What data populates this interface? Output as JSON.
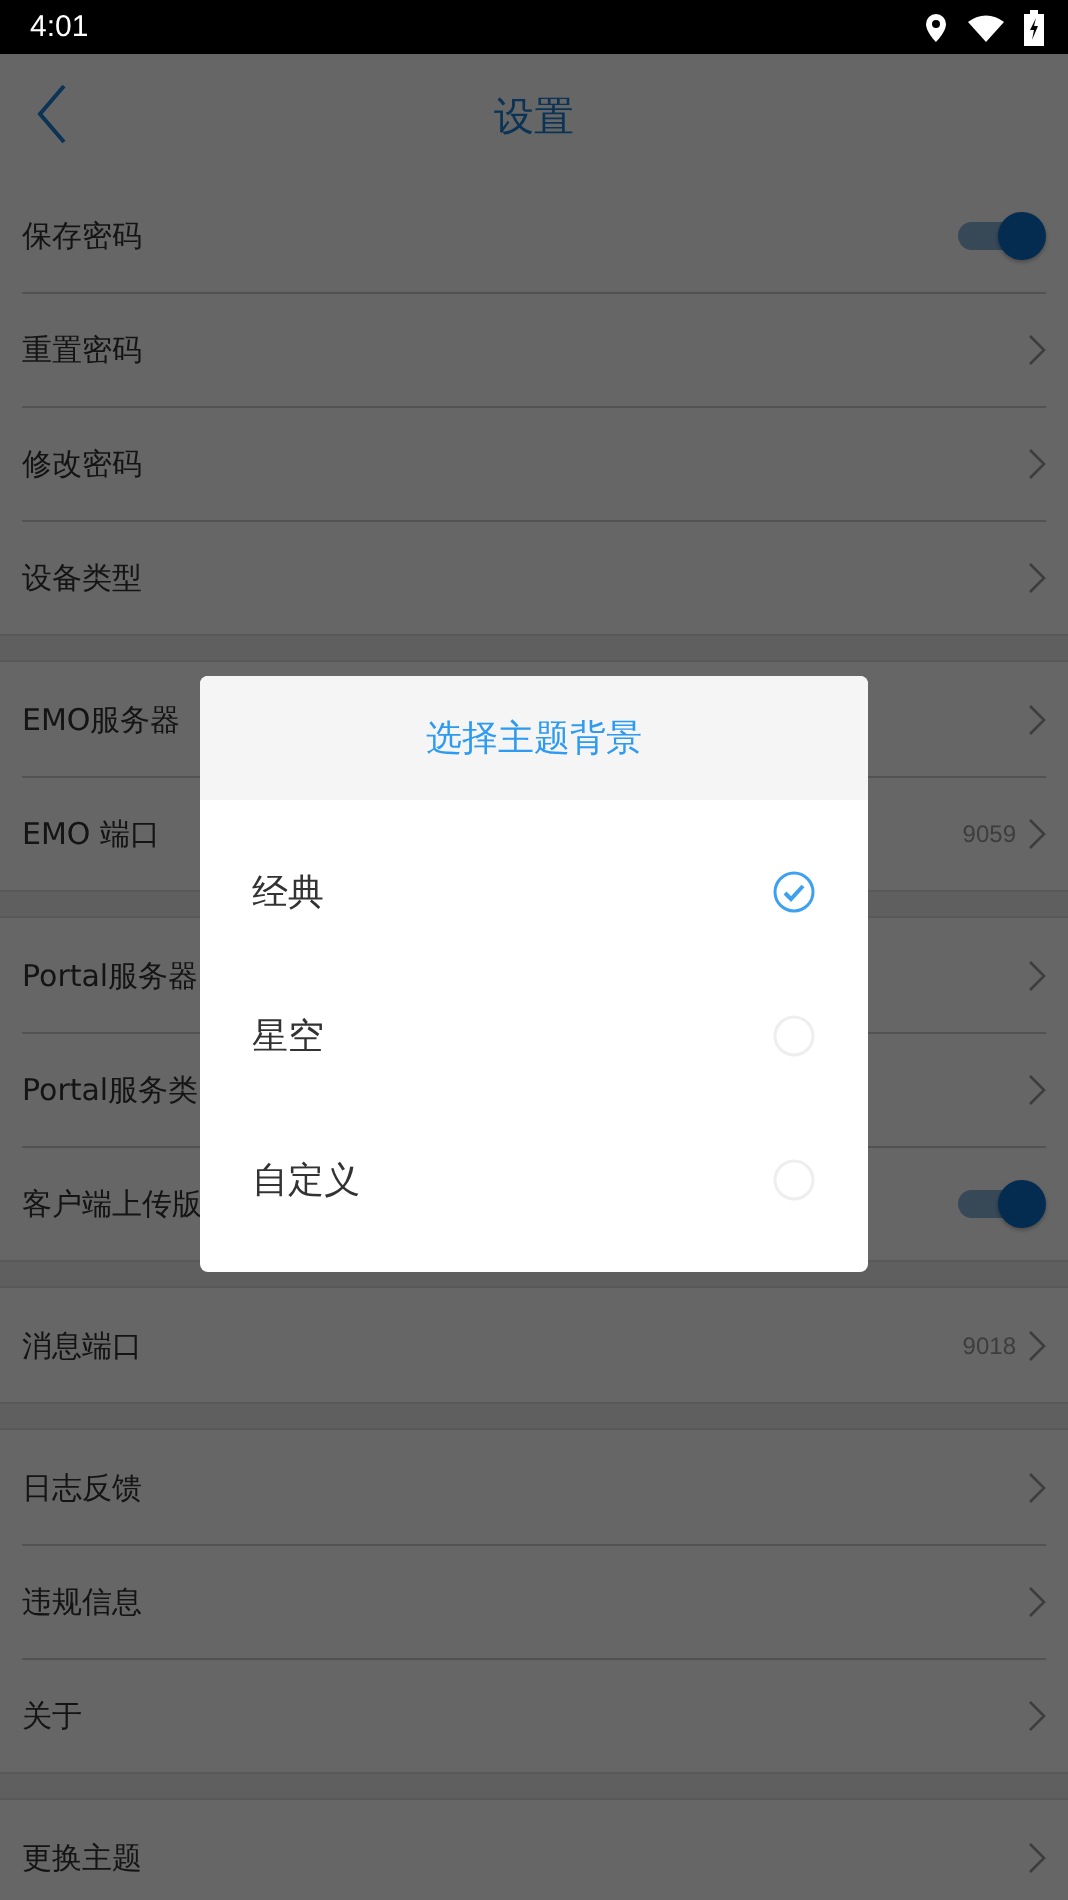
{
  "status_bar": {
    "time": "4:01"
  },
  "header": {
    "title": "设置"
  },
  "groups": [
    {
      "rows": [
        {
          "label": "保存密码",
          "kind": "toggle",
          "on": true
        },
        {
          "label": "重置密码",
          "kind": "link"
        },
        {
          "label": "修改密码",
          "kind": "link"
        },
        {
          "label": "设备类型",
          "kind": "link"
        }
      ]
    },
    {
      "rows": [
        {
          "label": "EMO服务器",
          "kind": "link"
        },
        {
          "label": "EMO 端口",
          "kind": "link",
          "value": "9059"
        }
      ]
    },
    {
      "rows": [
        {
          "label": "Portal服务器",
          "kind": "link"
        },
        {
          "label": "Portal服务类",
          "kind": "link"
        },
        {
          "label": "客户端上传版",
          "kind": "toggle",
          "on": true
        }
      ]
    },
    {
      "rows": [
        {
          "label": "消息端口",
          "kind": "link",
          "value": "9018"
        }
      ]
    },
    {
      "rows": [
        {
          "label": "日志反馈",
          "kind": "link"
        },
        {
          "label": "违规信息",
          "kind": "link"
        },
        {
          "label": "关于",
          "kind": "link"
        }
      ]
    },
    {
      "rows": [
        {
          "label": "更换主题",
          "kind": "link"
        }
      ]
    }
  ],
  "dialog": {
    "title": "选择主题背景",
    "options": [
      {
        "label": "经典",
        "selected": true
      },
      {
        "label": "星空",
        "selected": false
      },
      {
        "label": "自定义",
        "selected": false
      }
    ]
  }
}
